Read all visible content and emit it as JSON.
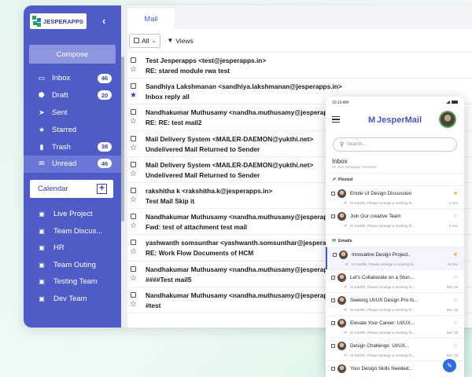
{
  "sidebar": {
    "logo_text": "JESPERAPPS",
    "compose_label": "Compose",
    "folders": [
      {
        "label": "Inbox",
        "count": "46",
        "icon": "inbox-icon"
      },
      {
        "label": "Draft",
        "count": "20",
        "icon": "draft-icon"
      },
      {
        "label": "Sent",
        "count": "",
        "icon": "sent-icon"
      },
      {
        "label": "Starred",
        "count": "",
        "icon": "star-icon"
      },
      {
        "label": "Trash",
        "count": "38",
        "icon": "trash-icon"
      },
      {
        "label": "Unread",
        "count": "46",
        "icon": "unread-icon"
      }
    ],
    "calendar_label": "Calendar",
    "teams": [
      {
        "label": "Live Project"
      },
      {
        "label": "Team Discus..."
      },
      {
        "label": "HR"
      },
      {
        "label": "Team Outing"
      },
      {
        "label": "Testing Team"
      },
      {
        "label": "Dev Team"
      }
    ]
  },
  "main": {
    "tab_label": "Mail",
    "all_label": "All",
    "views_label": "Views",
    "mails": [
      {
        "from": "Test Jesperapps <test@jesperapps.in>",
        "subject": "RE: stared module rwa test",
        "starred": false
      },
      {
        "from": "Sandhiya Lakshmanan <sandhiya.lakshmanan@jesperapps.in>",
        "subject": "Inbox reply all",
        "starred": true
      },
      {
        "from": "Nandhakumar Muthusamy <nandha.muthusamy@jesperapps.in>",
        "subject": "RE: RE: test mail2",
        "starred": false
      },
      {
        "from": "Mail Delivery System <MAILER-DAEMON@yukthi.net>",
        "subject": "Undelivered Mail Returned to Sender",
        "starred": false
      },
      {
        "from": "Mail Delivery System <MAILER-DAEMON@yukthi.net>",
        "subject": "Undelivered Mail Returned to Sender",
        "starred": false
      },
      {
        "from": "rakshitha k <rakshitha.k@jesperapps.in>",
        "subject": "Test Mail Skip it",
        "starred": false
      },
      {
        "from": "Nandhakumar Muthusamy <nandha.muthusamy@jesperapps.in>",
        "subject": "Fwd: test of attachment test mail",
        "starred": false
      },
      {
        "from": "yashwanth somsunthar <yashwanth.somsunthar@jesperapps.in>",
        "subject": "RE: Work Flow Documents of HCM",
        "starred": false
      },
      {
        "from": "Nandhakumar Muthusamy <nandha.muthusamy@jesperapps.in>",
        "subject": "####Test mail5",
        "starred": false
      },
      {
        "from": "Nandhakumar Muthusamy <nandha.muthusamy@jesperapps.in>",
        "subject": "#test",
        "starred": false
      }
    ]
  },
  "phone": {
    "time": "10:10 AM",
    "brand": "JesperMail",
    "search_placeholder": "Search...",
    "inbox_title": "Inbox",
    "inbox_sub": "01 new message received",
    "pinned_label": "Pinned",
    "emails_label": "Emails",
    "pinned": [
      {
        "name": "Enote UI Design Discussion",
        "preview": "Hi Karthik, Please arrange a meeting fo...",
        "time": "2 min",
        "starred": true
      },
      {
        "name": "Join Our creative Team",
        "preview": "Hi Karthik, Please arrange a meeting fo...",
        "time": "5 min",
        "starred": false
      }
    ],
    "emails": [
      {
        "name": "Innovative Design Project..",
        "preview": "Hi Karthik, Please arrange a meeting fo...",
        "time": "15 min",
        "starred": true,
        "selected": true
      },
      {
        "name": "Let's Collaborate on a Stun...",
        "preview": "Hi Karthik, Please arrange a meeting fo...",
        "time": "Dec 19",
        "starred": false
      },
      {
        "name": "Seeking UI/UX Design Pro fo...",
        "preview": "Hi Karthik, Please arrange a meeting fo...",
        "time": "Dec 19",
        "starred": false
      },
      {
        "name": "Elevate Your Career: UI/UX...",
        "preview": "Hi Karthik, Please arrange a meeting fo...",
        "time": "Dec 19",
        "starred": false
      },
      {
        "name": "Design Challenge: UI/UX...",
        "preview": "Hi Karthik, Please arrange a meeting fo...",
        "time": "Dec 18",
        "starred": false
      },
      {
        "name": "Your Design Skills Needed...",
        "preview": "Hi Karthik, Please arrange a meeting fo...",
        "time": "Dec 18",
        "starred": false
      }
    ]
  },
  "colors": {
    "sidebar": "#4f5cc8",
    "accent": "#2f3fd0",
    "star_active": "#f1a81b",
    "fab": "#2f6ee0"
  }
}
